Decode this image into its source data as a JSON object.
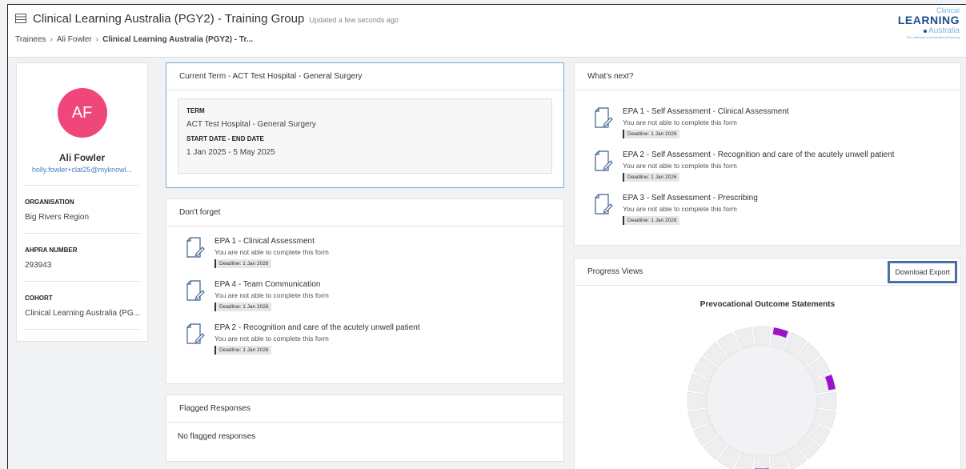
{
  "header": {
    "title": "Clinical Learning Australia (PGY2) - Training Group",
    "updated": "Updated a few seconds ago",
    "breadcrumb": [
      "Trainees",
      "Ali Fowler",
      "Clinical Learning Australia (PGY2) - Tr..."
    ],
    "logo": {
      "line1": "Clinical",
      "line2": "LEARNING",
      "line3": "Australia",
      "line4": "The pathway to prevocational training"
    }
  },
  "profile": {
    "initials": "AF",
    "name": "Ali Fowler",
    "email": "holly.fowler+clat25@myknowl...",
    "fields": [
      {
        "label": "ORGANISATION",
        "value": "Big Rivers Region"
      },
      {
        "label": "AHPRA NUMBER",
        "value": "293943"
      },
      {
        "label": "COHORT",
        "value": "Clinical Learning Australia (PG..."
      }
    ]
  },
  "term": {
    "heading": "Current Term - ACT Test Hospital - General Surgery",
    "term_label": "TERM",
    "term_value": "ACT Test Hospital - General Surgery",
    "date_label": "START DATE - END DATE",
    "date_value": "1 Jan 2025 - 5 May 2025"
  },
  "dont_forget": {
    "heading": "Don't forget",
    "items": [
      {
        "title": "EPA 1 - Clinical Assessment",
        "sub": "You are not able to complete this form",
        "deadline": "Deadline: 1 Jan 2026"
      },
      {
        "title": "EPA 4 - Team Communication",
        "sub": "You are not able to complete this form",
        "deadline": "Deadline: 1 Jan 2026"
      },
      {
        "title": "EPA 2 - Recognition and care of the acutely unwell patient",
        "sub": "You are not able to complete this form",
        "deadline": "Deadline: 1 Jan 2026"
      }
    ]
  },
  "whats_next": {
    "heading": "What's next?",
    "items": [
      {
        "title": "EPA 1 - Self Assessment - Clinical Assessment",
        "sub": "You are not able to complete this form",
        "deadline": "Deadline: 1 Jan 2026"
      },
      {
        "title": "EPA 2 - Self Assessment - Recognition and care of the acutely unwell patient",
        "sub": "You are not able to complete this form",
        "deadline": "Deadline: 1 Jan 2026"
      },
      {
        "title": "EPA 3 - Self Assessment - Prescribing",
        "sub": "You are not able to complete this form",
        "deadline": "Deadline: 1 Jan 2026"
      }
    ]
  },
  "flagged": {
    "heading": "Flagged Responses",
    "empty": "No flagged responses"
  },
  "progress": {
    "heading": "Progress Views",
    "download_label": "Download Export",
    "chart_title": "Prevocational Outcome Statements",
    "segment_count": 24,
    "highlighted_segments": [
      1,
      5,
      12
    ],
    "accent_color": "#9b12c9",
    "track_color": "#eeeef0"
  },
  "colors": {
    "avatar": "#f0477a",
    "link": "#4a7fc0",
    "focus_border": "#7aa6d6"
  }
}
